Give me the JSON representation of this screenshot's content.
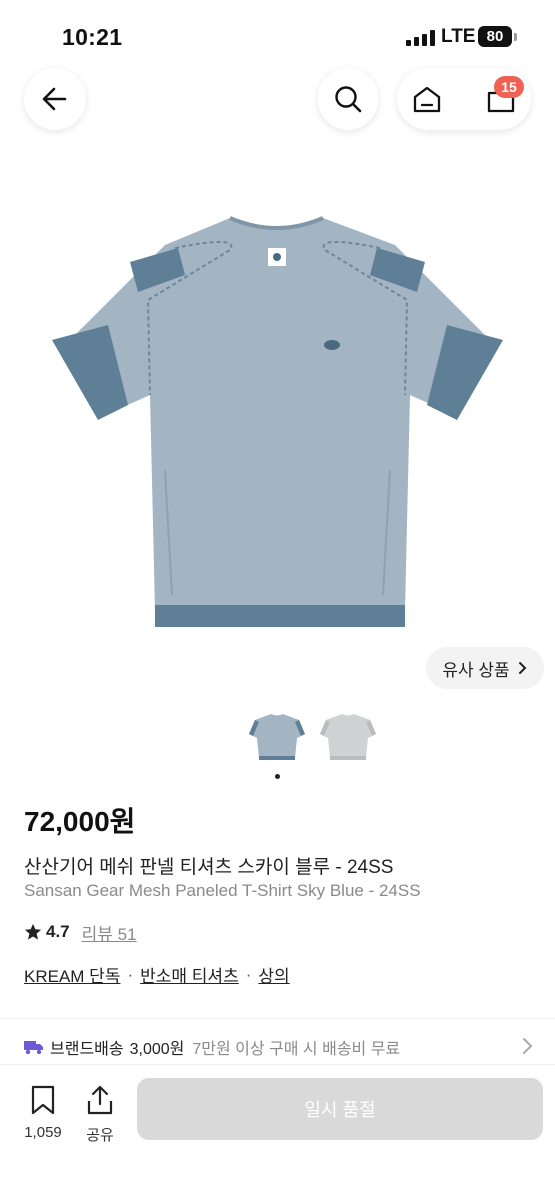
{
  "status_bar": {
    "time": "10:21",
    "network": "LTE",
    "battery": "80"
  },
  "header": {
    "back_icon": "arrow-left-icon",
    "search_icon": "search-icon",
    "home_icon": "home-icon",
    "bag_icon": "shopping-bag-icon",
    "cart_count": "15"
  },
  "product": {
    "image_icon": "t-shirt-image",
    "similar_label": "유사 상품",
    "thumbnails": [
      "sky-blue-shirt-thumb",
      "grey-shirt-thumb"
    ],
    "active_thumbnail": 0,
    "price": "72,000원",
    "name_ko": "산산기어 메쉬 판넬 티셔츠 스카이 블루 - 24SS",
    "name_en": "Sansan Gear Mesh Paneled T-Shirt Sky Blue - 24SS",
    "rating": "4.7",
    "review_label": "리뷰 51",
    "tags": [
      "KREAM 단독",
      "반소매 티셔츠",
      "상의"
    ]
  },
  "shipping": {
    "icon": "truck-icon",
    "label": "브랜드배송",
    "price": "3,000원",
    "note": "7만원 이상 구매 시 배송비 무료"
  },
  "bottom_bar": {
    "bookmark_count": "1,059",
    "share_label": "공유",
    "soldout_label": "일시 품절"
  },
  "colors": {
    "badge": "#ef6253",
    "shirt": "#a3b4c3",
    "shirt_panel": "#5e7f96",
    "soldout_button": "#d9d9d9",
    "truck": "#6b5bd6"
  }
}
